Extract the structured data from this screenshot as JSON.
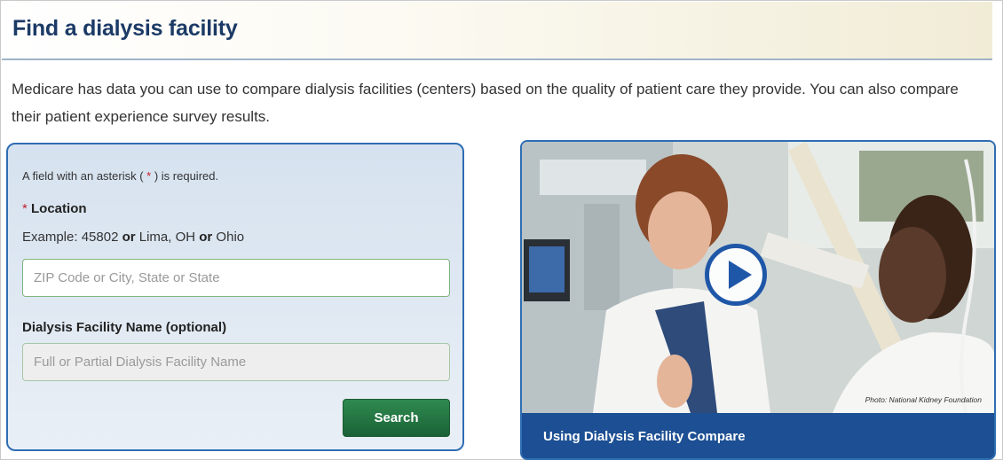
{
  "header": {
    "title": "Find a dialysis facility"
  },
  "intro": {
    "text": "Medicare has data you can use to compare dialysis facilities (centers) based on the quality of patient care they provide. You can also compare their patient experience survey results."
  },
  "form": {
    "required_note_prefix": "A field with an asterisk ( ",
    "required_star": "*",
    "required_note_suffix": " ) is required.",
    "location_star": "*",
    "location_label": "Location",
    "example_prefix": "Example: 45802 ",
    "example_or1": "or",
    "example_mid": " Lima, OH ",
    "example_or2": "or",
    "example_suffix": " Ohio",
    "location_placeholder": "ZIP Code or City, State or State",
    "location_value": "",
    "facility_label": "Dialysis Facility Name (optional)",
    "facility_placeholder": "Full or Partial Dialysis Facility Name",
    "facility_value": "",
    "search_label": "Search"
  },
  "video": {
    "caption": "Using Dialysis Facility Compare",
    "photo_credit": "Photo: National Kidney Foundation",
    "play_icon": "play-icon"
  },
  "colors": {
    "title_blue": "#1b3a66",
    "panel_border": "#2f6db3",
    "search_green": "#1a6237",
    "caption_blue": "#1c4f93",
    "required_red": "#c4202f"
  }
}
